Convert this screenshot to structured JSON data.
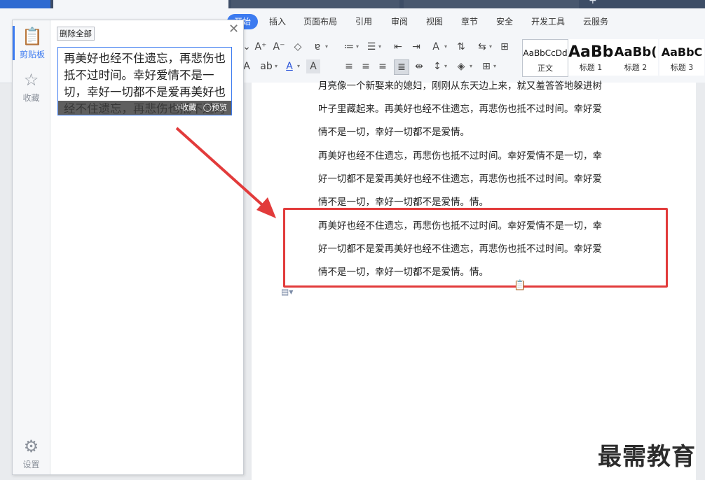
{
  "menu": {
    "items": [
      "开始",
      "插入",
      "页面布局",
      "引用",
      "审阅",
      "视图",
      "章节",
      "安全",
      "开发工具",
      "云服务"
    ]
  },
  "styles": {
    "items": [
      {
        "sample": "AaBbCcDd",
        "name": "正文"
      },
      {
        "sample": "AaBb",
        "name": "标题 1"
      },
      {
        "sample": "AaBb(",
        "name": "标题 2"
      },
      {
        "sample": "AaBbC",
        "name": "标题 3"
      }
    ]
  },
  "clipboard": {
    "tab_clipboard": "剪贴板",
    "tab_favorites": "收藏",
    "tab_settings": "设置",
    "delete_all": "删除全部",
    "item_text": "再美好也经不住遗忘，再悲伤也抵不过时间。幸好爱情不是一切，幸好一切都不是爱再美好也经不住遗忘，再悲伤也抵不过时间。幸好爱",
    "action_favorite": "☆收藏",
    "action_preview": "◯预览"
  },
  "document": {
    "para1": [
      "月亮像一个新娶来的媳妇，刚刚从东天边上来，就又羞答答地躲进树",
      "叶子里藏起来。再美好也经不住遗忘，再悲伤也抵不过时间。幸好爱",
      "情不是一切，幸好一切都不是爱情。"
    ],
    "para2": [
      "再美好也经不住遗忘，再悲伤也抵不过时间。幸好爱情不是一切，幸",
      "好一切都不是爱再美好也经不住遗忘，再悲伤也抵不过时间。幸好爱",
      "情不是一切，幸好一切都不是爱情。情。"
    ],
    "para3": [
      "再美好也经不住遗忘，再悲伤也抵不过时间。幸好爱情不是一切，幸",
      "好一切都不是爱再美好也经不住遗忘，再悲伤也抵不过时间。幸好爱",
      "情不是一切，幸好一切都不是爱情。情。"
    ]
  },
  "watermark": "最需教育",
  "colors": {
    "accent": "#3d7bf0",
    "highlight": "#e23b3b"
  }
}
